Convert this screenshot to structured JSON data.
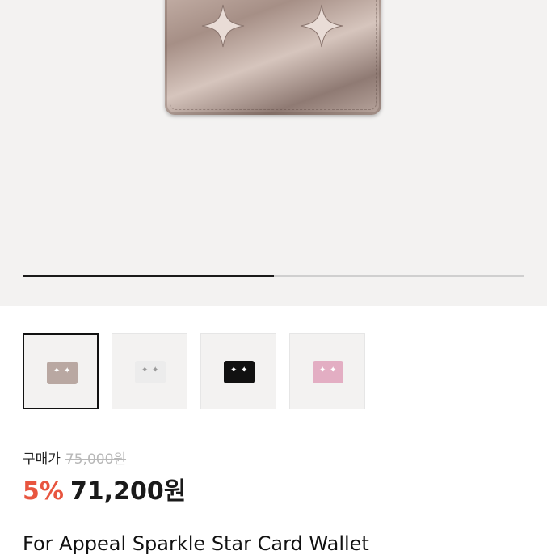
{
  "product": {
    "gallery": {
      "progress_fraction": 0.5
    },
    "thumbnails": [
      {
        "name": "thumb-rose-gold",
        "color": "#b9a8a2",
        "star_color": "#ffffff",
        "selected": true
      },
      {
        "name": "thumb-white",
        "color": "#ececec",
        "star_color": "#9a9a9a",
        "selected": false
      },
      {
        "name": "thumb-black",
        "color": "#111111",
        "star_color": "#ffffff",
        "selected": false
      },
      {
        "name": "thumb-pink",
        "color": "#e3aec3",
        "star_color": "#ffffff",
        "selected": false
      }
    ],
    "price_label": "구매가",
    "original_price": "75,000원",
    "discount": "5%",
    "final_price": "71,200원",
    "title": "For Appeal Sparkle Star Card Wallet"
  },
  "colors": {
    "accent": "#e8553f",
    "text": "#1a1a1a",
    "muted": "#b8b8b8",
    "hero_bg": "#f3f2f1"
  },
  "icons": {
    "wallet_emblem": "four-point-star-icon"
  }
}
